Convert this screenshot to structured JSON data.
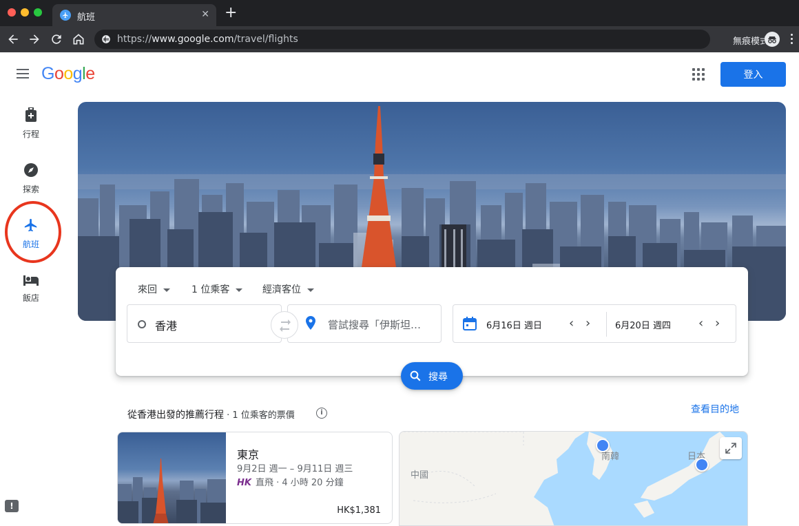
{
  "browser": {
    "tab_title": "航班",
    "tab_close": "✕",
    "new_tab": "+",
    "url_scheme": "https://",
    "url_host": "www.google.com",
    "url_path": "/travel/flights",
    "incognito_label": "無痕模式"
  },
  "header": {
    "logo_letters": [
      "G",
      "o",
      "o",
      "g",
      "l",
      "e"
    ],
    "signin_label": "登入"
  },
  "rail": {
    "items": [
      {
        "label": "行程",
        "icon": "luggage-icon"
      },
      {
        "label": "探索",
        "icon": "compass-icon"
      },
      {
        "label": "航班",
        "icon": "airplane-icon",
        "active": true
      },
      {
        "label": "飯店",
        "icon": "bed-icon"
      }
    ]
  },
  "search": {
    "trip_type": "來回",
    "passengers": "1 位乘客",
    "cabin_class": "經濟客位",
    "origin_value": "香港",
    "destination_placeholder": "嘗試搜尋「伊斯坦…",
    "depart_date": "6月16日 週日",
    "return_date": "6月20日 週四",
    "search_label": "搜尋"
  },
  "recommendations": {
    "title": "從香港出發的推薦行程",
    "subtitle": " · 1 位乘客的票價",
    "see_destinations": "查看目的地",
    "cards": [
      {
        "city": "東京",
        "dates": "9月2日 週一 – 9月11日 週三",
        "airline_code": "HK",
        "flight_info": "直飛 · 4 小時 20 分鐘",
        "price": "HK$1,381"
      }
    ]
  },
  "map": {
    "labels": [
      "中國",
      "南韓",
      "日本"
    ]
  },
  "colors": {
    "accent": "#1a73e8",
    "annotation_circle": "#e8361e",
    "airline": "#7b2e8e"
  }
}
